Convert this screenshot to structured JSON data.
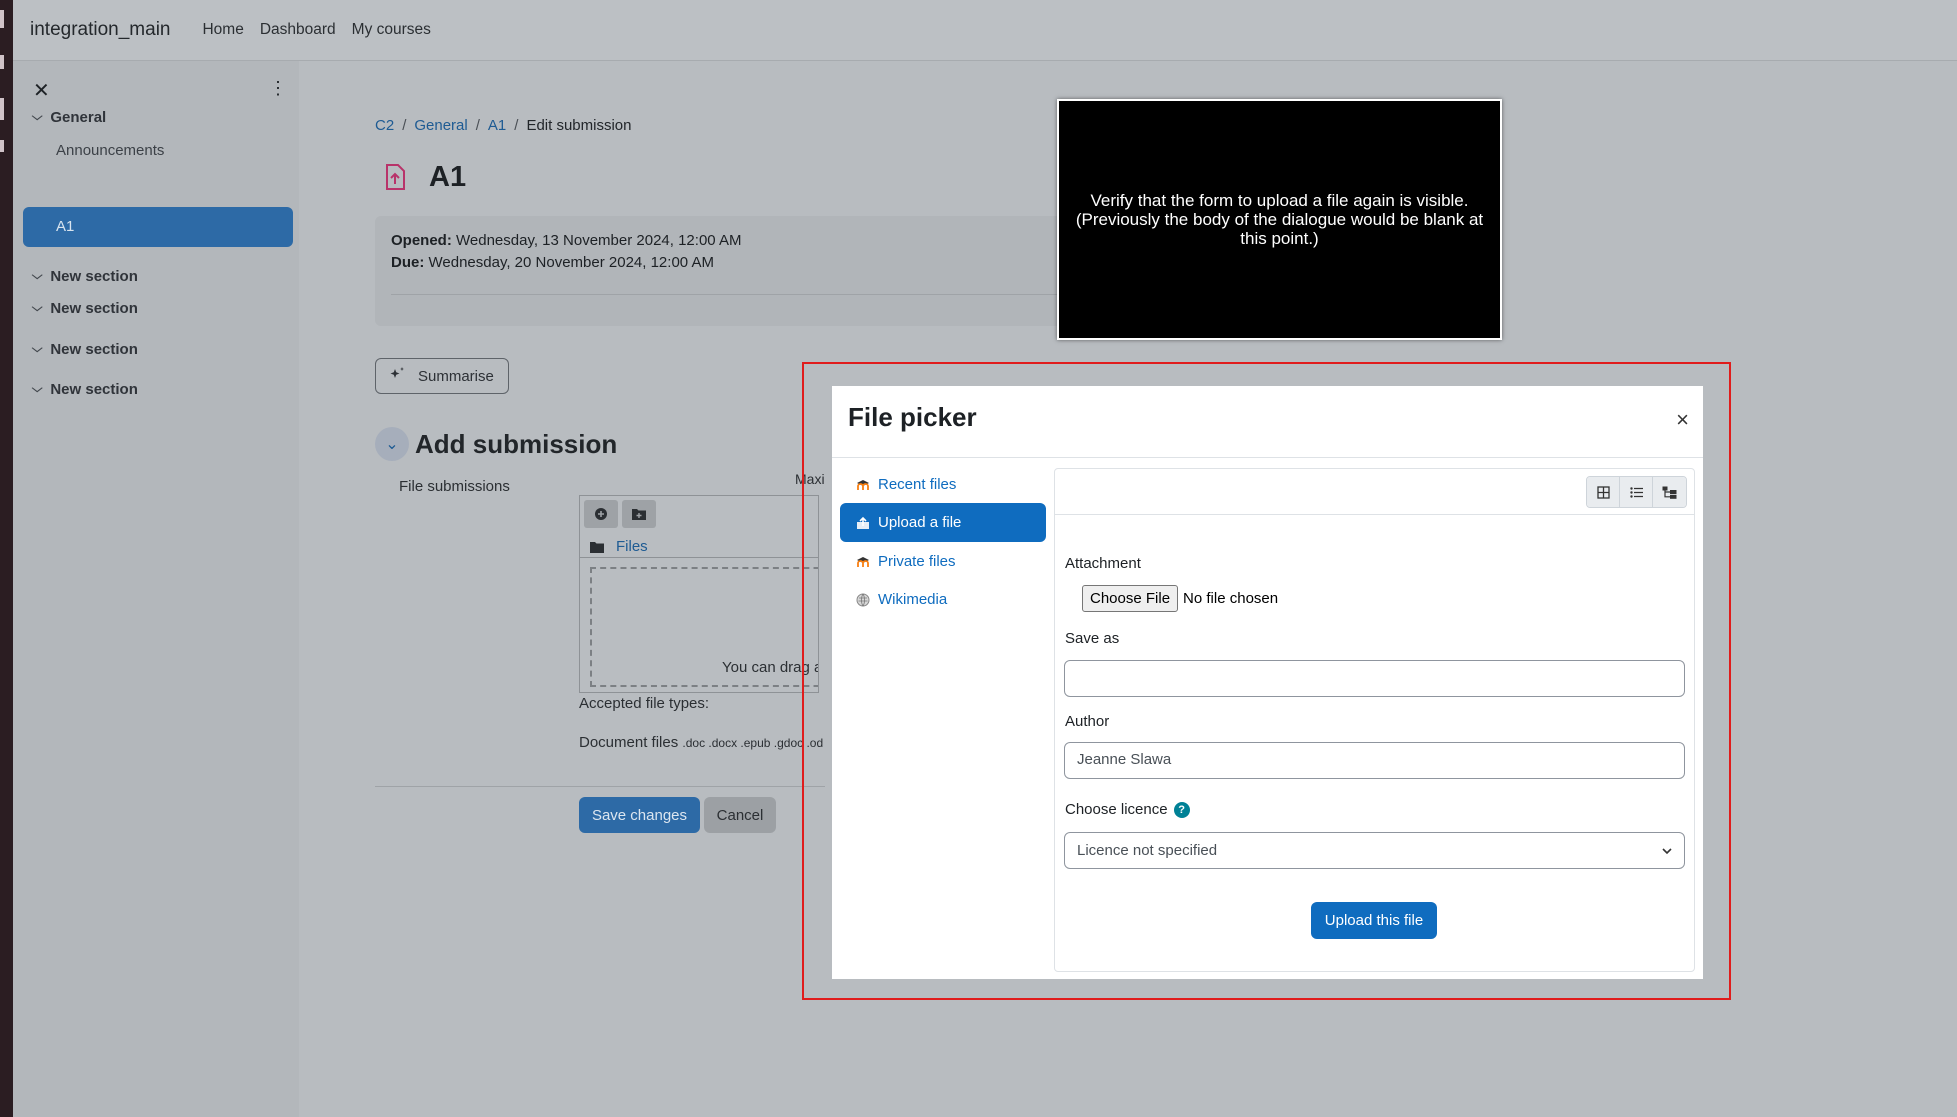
{
  "navbar": {
    "brand": "integration_main",
    "links": [
      "Home",
      "Dashboard",
      "My courses"
    ]
  },
  "drawer": {
    "sections": [
      {
        "label": "General",
        "items": [
          "Announcements",
          "A1"
        ]
      },
      {
        "label": "New section"
      },
      {
        "label": "New section"
      },
      {
        "label": "New section"
      },
      {
        "label": "New section"
      }
    ]
  },
  "breadcrumb": {
    "items": [
      "C2",
      "General",
      "A1"
    ],
    "current": "Edit submission",
    "separator": "/"
  },
  "page": {
    "title": "A1",
    "opened_label": "Opened:",
    "opened_value": "Wednesday, 13 November 2024, 12:00 AM",
    "due_label": "Due:",
    "due_value": "Wednesday, 20 November 2024, 12:00 AM",
    "summarise_label": "Summarise",
    "add_submission_title": "Add submission",
    "file_submissions_label": "File submissions",
    "max_label_fragment": "Maxi",
    "files_folder_label": "Files",
    "drop_text_fragment": "You can drag and",
    "accepted_label": "Accepted file types:",
    "document_files_label": "Document files",
    "document_files_exts": ".doc .docx .epub .gdoc .od",
    "save_label": "Save changes",
    "cancel_label": "Cancel"
  },
  "overlay_note": {
    "text": "Verify that the form to upload a file again is visible. (Previously the body of the dialogue would be blank at this point.)"
  },
  "file_picker": {
    "title": "File picker",
    "close_glyph": "×",
    "repositories": [
      {
        "label": "Recent files",
        "icon": "moodle-icon",
        "active": false
      },
      {
        "label": "Upload a file",
        "icon": "upload-icon",
        "active": true
      },
      {
        "label": "Private files",
        "icon": "moodle-icon",
        "active": false
      },
      {
        "label": "Wikimedia",
        "icon": "wikimedia-icon",
        "active": false
      }
    ],
    "views": [
      "grid-view-icon",
      "list-view-icon",
      "tree-view-icon"
    ],
    "form": {
      "attachment_label": "Attachment",
      "choose_button": "Choose File",
      "no_file_text": "No file chosen",
      "save_as_label": "Save as",
      "save_as_value": "",
      "author_label": "Author",
      "author_value": "Jeanne Slawa",
      "licence_label": "Choose licence",
      "licence_help": "?",
      "licence_selected": "Licence not specified",
      "upload_button": "Upload this file"
    }
  },
  "colors": {
    "primary": "#0f6cbf",
    "highlight_frame": "#e01c1c",
    "drawer_active": "#2d6aa6",
    "help_icon": "#008196"
  }
}
